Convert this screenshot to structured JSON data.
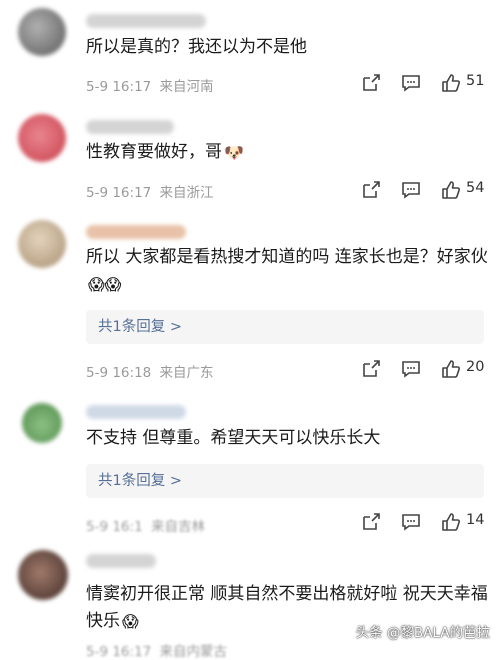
{
  "comments": [
    {
      "text": "所以是真的？我还以为不是他",
      "emoji": "",
      "time": "5-9 16:17",
      "location": "来自河南",
      "likes": "51",
      "reply": "",
      "avatar_color": "#8a8a8a"
    },
    {
      "text": "性教育要做好，哥",
      "emoji": "🐶",
      "time": "5-9 16:17",
      "location": "来自浙江",
      "likes": "54",
      "reply": "",
      "avatar_color": "#d8505a"
    },
    {
      "text": "所以 大家都是看热搜才知道的吗 连家长也是？好家伙",
      "emoji": "😱😱",
      "time": "5-9 16:18",
      "location": "来自广东",
      "likes": "20",
      "reply": "共1条回复 >",
      "avatar_color": "#c9b59a"
    },
    {
      "text": "不支持 但尊重。希望天天可以快乐长大",
      "emoji": "",
      "time": "5-9 16:1",
      "location": "来自吉林",
      "likes": "14",
      "reply": "共1条回复 >",
      "avatar_color": "#6fae6a"
    },
    {
      "text": "情窦初开很正常 顺其自然不要出格就好啦 祝天天幸福快乐",
      "emoji": "😱",
      "time": "5-9 16:17",
      "location": "来自内蒙古",
      "likes": "",
      "reply": "",
      "avatar_color": "#6d4f48"
    }
  ],
  "watermark": "头条 @黎BALA的芭拉"
}
